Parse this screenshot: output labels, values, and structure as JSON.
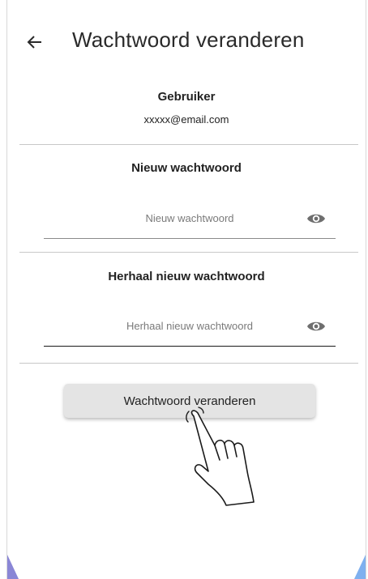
{
  "appbar": {
    "back_icon": "arrow-left-icon",
    "title": "Wachtwoord veranderen"
  },
  "user_section": {
    "heading": "Gebruiker",
    "email": "xxxxx@email.com"
  },
  "new_password": {
    "heading": "Nieuw wachtwoord",
    "placeholder": "Nieuw wachtwoord",
    "value": "",
    "toggle_icon": "eye-icon"
  },
  "repeat_password": {
    "heading": "Herhaal nieuw wachtwoord",
    "placeholder": "Herhaal nieuw wachtwoord",
    "value": "",
    "toggle_icon": "eye-icon"
  },
  "submit": {
    "label": "Wachtwoord veranderen"
  },
  "overlay": {
    "gesture_icon": "tapping-hand-icon"
  },
  "colors": {
    "button_bg": "#e4e4e4",
    "divider": "#c8c8c8",
    "corner_left": "#8a86d6",
    "corner_right": "#7fb0ef"
  }
}
